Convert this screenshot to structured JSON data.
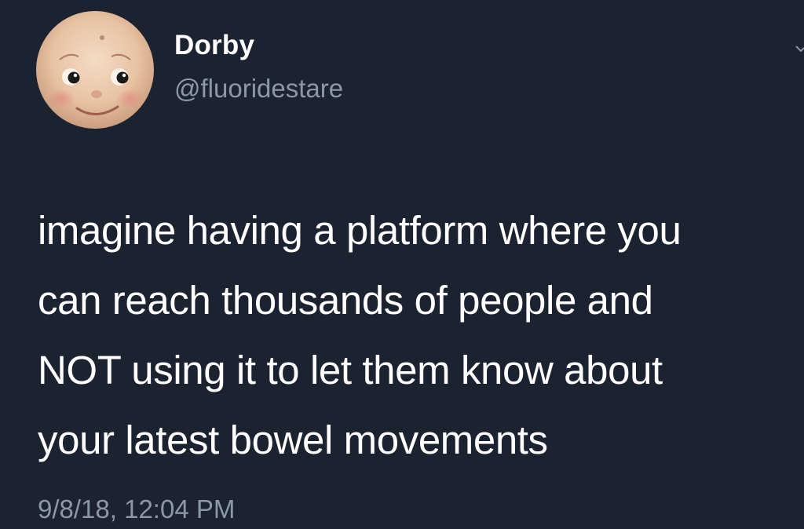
{
  "author": {
    "display_name": "Dorby",
    "handle": "@fluoridestare",
    "avatar": "kewpie-doll-face-avatar"
  },
  "tweet": {
    "lines": [
      "imagine having a platform where you",
      "can reach thousands of people and",
      "NOT using it to let them know about",
      "your latest bowel movements"
    ],
    "timestamp": "9/8/18, 12:04 PM"
  },
  "icons": {
    "menu": "chevron-down-icon"
  },
  "colors": {
    "background": "#1c2330",
    "primary_text": "#ffffff",
    "secondary_text": "#8b98a5"
  }
}
